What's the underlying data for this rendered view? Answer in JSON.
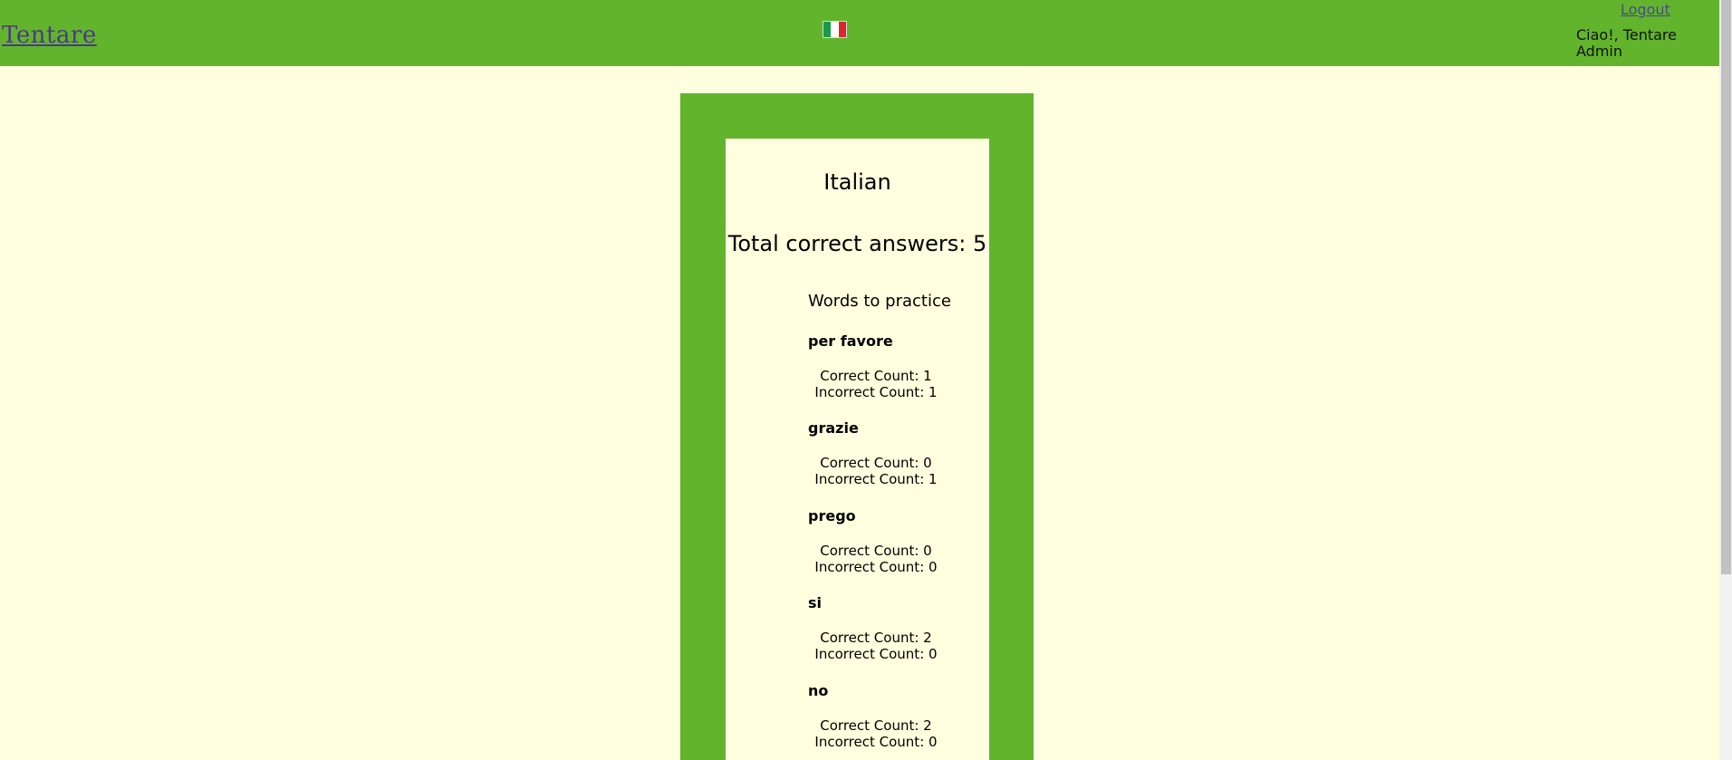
{
  "header": {
    "brand": "Tentare",
    "flag": "italian-flag-icon",
    "logout_label": "Logout",
    "greeting": "Ciao!, Tentare Admin"
  },
  "main": {
    "language": "Italian",
    "total_correct": "Total correct answers: 5",
    "practice_heading": "Words to practice",
    "words": [
      {
        "word": "per favore",
        "correct": "Correct Count: 1",
        "incorrect": "Incorrect Count: 1"
      },
      {
        "word": "grazie",
        "correct": "Correct Count: 0",
        "incorrect": "Incorrect Count: 1"
      },
      {
        "word": "prego",
        "correct": "Correct Count: 0",
        "incorrect": "Incorrect Count: 0"
      },
      {
        "word": "si",
        "correct": "Correct Count: 2",
        "incorrect": "Incorrect Count: 0"
      },
      {
        "word": "no",
        "correct": "Correct Count: 2",
        "incorrect": "Incorrect Count: 0"
      }
    ]
  },
  "colors": {
    "accent_green": "#62b42c",
    "background": "#ffffdf"
  }
}
